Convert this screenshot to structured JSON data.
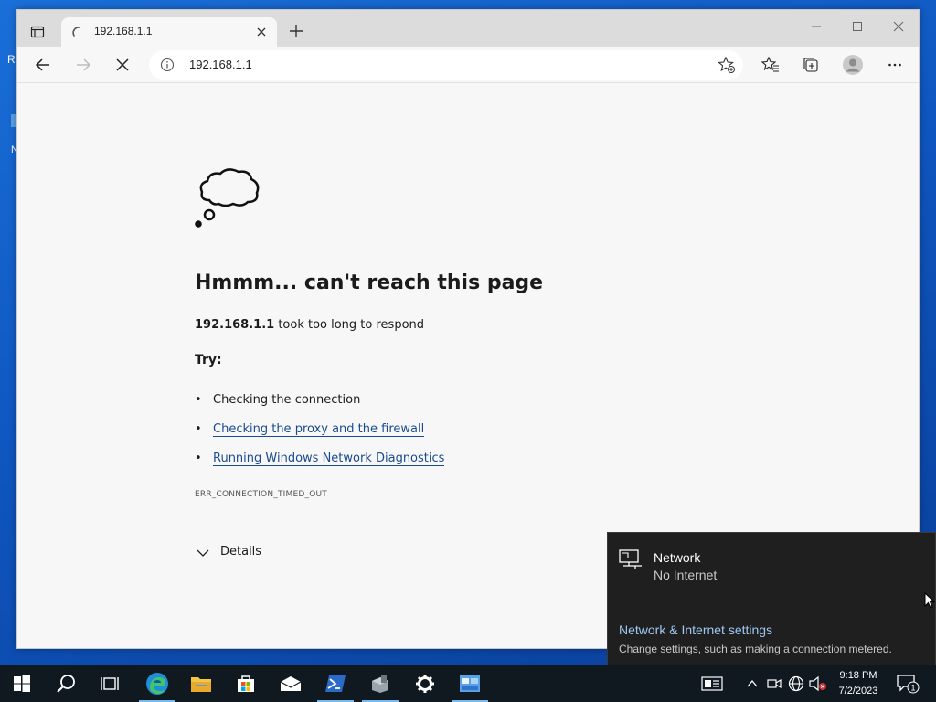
{
  "desktop": {
    "left_label": "R",
    "partial_icon_text": "N"
  },
  "browser": {
    "tab": {
      "title": "192.168.1.1"
    },
    "address_bar": {
      "url": "192.168.1.1"
    }
  },
  "error_page": {
    "title": "Hmmm... can't reach this page",
    "host": "192.168.1.1",
    "message": " took too long to respond",
    "try_label": "Try:",
    "suggestions": [
      {
        "text": "Checking the connection",
        "is_link": false
      },
      {
        "text": "Checking the proxy and the firewall",
        "is_link": true
      },
      {
        "text": "Running Windows Network Diagnostics",
        "is_link": true
      }
    ],
    "error_code": "ERR_CONNECTION_TIMED_OUT",
    "details_label": "Details"
  },
  "network_flyout": {
    "network_name": "Network",
    "status": "No Internet",
    "settings_link": "Network & Internet settings",
    "settings_desc": "Change settings, such as making a connection metered."
  },
  "taskbar": {
    "apps": [
      "start-icon",
      "search-icon",
      "task-view-icon",
      "edge-icon",
      "file-explorer-icon",
      "store-icon",
      "mail-icon",
      "powershell-icon",
      "server-manager-icon",
      "settings-icon",
      "control-panel-icon"
    ],
    "clock": {
      "time": "9:18 PM",
      "date": "7/2/2023"
    },
    "notification_count": "1"
  },
  "colors": {
    "link": "#1a4b8f",
    "flyout_bg": "#1f1f1f",
    "flyout_link": "#9fc8f2",
    "taskbar_bg": "#101820",
    "accent": "#0078d4"
  }
}
